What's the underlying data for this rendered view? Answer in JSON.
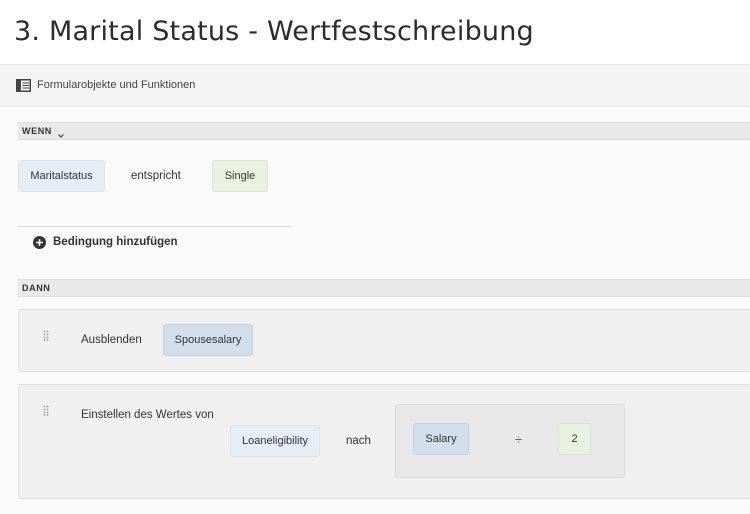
{
  "page": {
    "title": "3. Marital Status - Wertfestschreibung"
  },
  "toolbar": {
    "label": "Formularobjekte und Funktionen",
    "icon": "panel-icon"
  },
  "when_section": {
    "label": "WENN",
    "condition": {
      "field": "Maritalstatus",
      "operator": "entspricht",
      "value": "Single"
    },
    "add_condition_label": "Bedingung hinzufügen"
  },
  "then_section": {
    "label": "DANN",
    "actions": [
      {
        "verb": "Ausblenden",
        "target": "Spousesalary"
      },
      {
        "verb": "Einstellen des Wertes von",
        "target": "Loaneligibility",
        "connector": "nach",
        "expression": {
          "operand": "Salary",
          "operator": "÷",
          "value": "2"
        }
      }
    ]
  },
  "colors": {
    "field_token": "#e5edf5",
    "field_token_selected": "#d2deec",
    "value_token": "#e9f1e1",
    "section_bar": "#e9e9e9"
  }
}
